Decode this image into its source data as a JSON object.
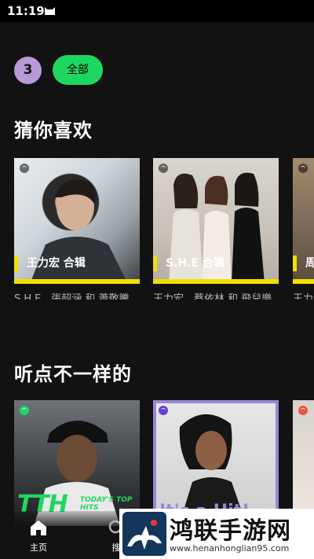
{
  "status": {
    "time": "11:19"
  },
  "filters": {
    "avatar_letter": "3",
    "chip_all": "全部"
  },
  "sections": [
    {
      "title": "猜你喜欢",
      "cards": [
        {
          "label": "王力宏 合辑",
          "desc": "S.H.E、張韶涵 和 蕭敬騰",
          "bar_color": "#f0e100"
        },
        {
          "label": "S.H.E 合辑",
          "desc": "王力宏、蔡依林 和 飛兒樂團",
          "bar_color": "#f0e100"
        },
        {
          "label": "周",
          "desc": "王力",
          "bar_color": "#f0e100"
        }
      ]
    },
    {
      "title": "听点不一样的",
      "cards": [
        {
          "label": "TODAY'S TOP HITS",
          "desc": ""
        },
        {
          "label": "It's a Hit!",
          "desc": ""
        },
        {
          "label": "",
          "desc": ""
        }
      ]
    }
  ],
  "nav": {
    "home": "主页",
    "search": "搜"
  },
  "watermark": {
    "title": "鸿联手游网",
    "url": "www.henanhonglian95.com"
  },
  "colors": {
    "accent": "#1ed760",
    "avatar": "#b79bd8",
    "bar": "#f0e100",
    "background": "#121212"
  }
}
